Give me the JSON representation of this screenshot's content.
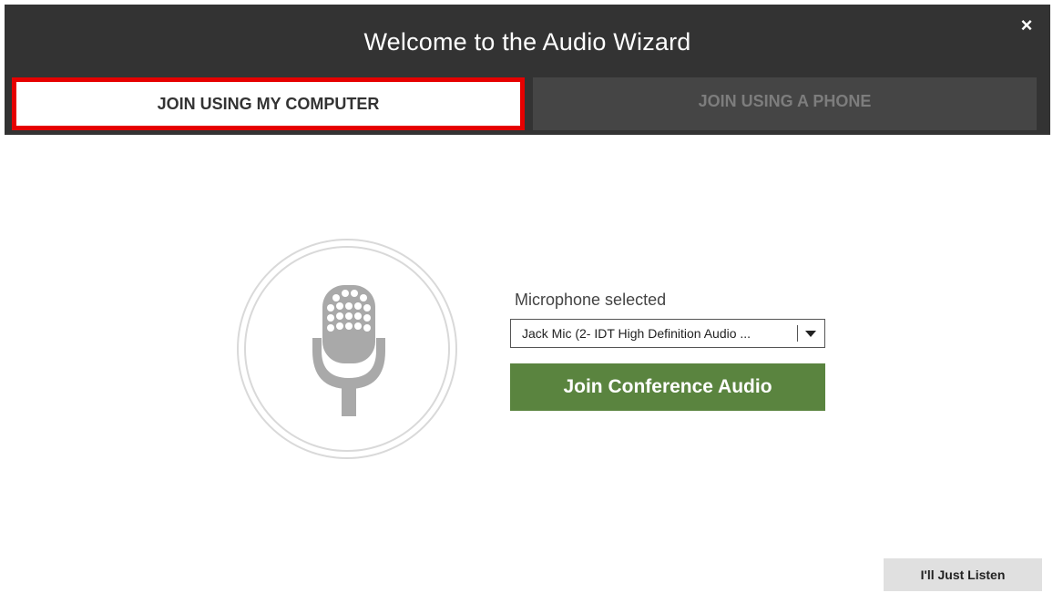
{
  "dialog": {
    "title": "Welcome to the Audio Wizard",
    "close_label": "×"
  },
  "tabs": [
    {
      "label": "JOIN USING MY COMPUTER",
      "active": true
    },
    {
      "label": "JOIN USING A PHONE",
      "active": false
    }
  ],
  "microphone": {
    "label": "Microphone selected",
    "selected": "Jack Mic (2- IDT High Definition Audio ...",
    "icon": "microphone-icon"
  },
  "actions": {
    "join_label": "Join Conference Audio",
    "listen_label": "I'll Just Listen"
  },
  "colors": {
    "header_bg": "#333333",
    "active_tab_highlight": "#e60000",
    "join_button": "#5a843f"
  }
}
